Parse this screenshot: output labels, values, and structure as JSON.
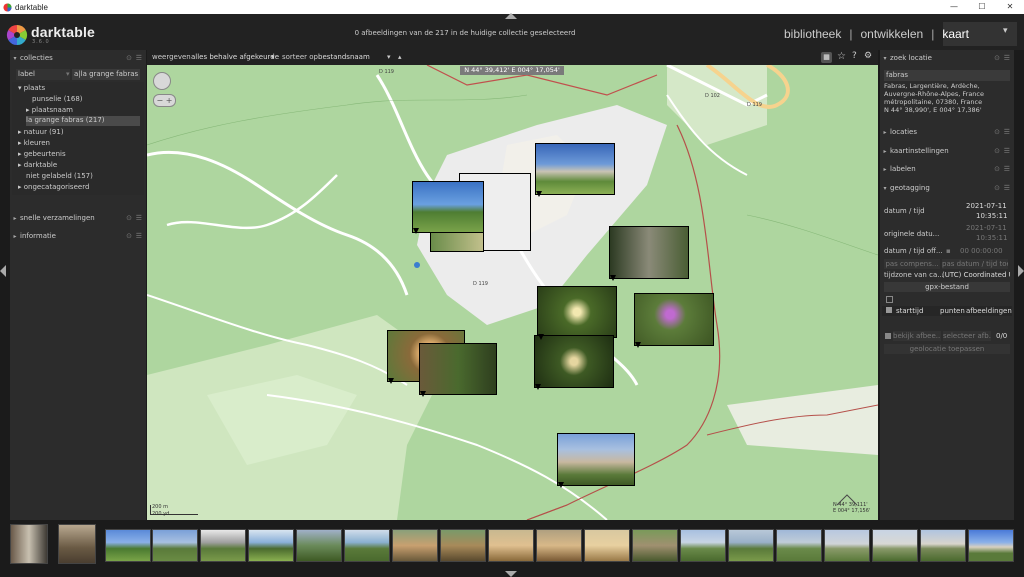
{
  "window": {
    "title": "darktable",
    "minimize": "—",
    "maximize": "☐",
    "close": "✕"
  },
  "header": {
    "logo_text": "darktable",
    "logo_sub": "3.6.0",
    "status": "0 afbeeldingen van de 217 in de huidige collectie geselecteerd",
    "views": [
      "bibliotheek",
      "ontwikkelen",
      "kaart"
    ],
    "active_view": "kaart",
    "views_dropdown": "▾"
  },
  "left": {
    "collecties": {
      "title": "collecties",
      "label_field": "label",
      "label_value": "a|la grange fabras",
      "tree": [
        {
          "text": "▾ plaats"
        },
        {
          "text": "punselie (168)"
        },
        {
          "text": "▸ plaatsnaam"
        },
        {
          "text": "la grange fabras (217)"
        },
        {
          "text": "▸ natuur (91)"
        },
        {
          "text": "▸ kleuren"
        },
        {
          "text": "▸ gebeurtenis"
        },
        {
          "text": "▸ darktable"
        },
        {
          "text": "niet gelabeld (157)"
        },
        {
          "text": "▸ ongecatagoriseerd"
        }
      ]
    },
    "snelle": {
      "title": "snelle verzamelingen"
    },
    "informatie": {
      "title": "informatie"
    }
  },
  "toolbar": {
    "weergeven_label": "weergeven",
    "weergeven_value": "alles behalve afgekeurde",
    "sorteer_label": "sorteer op",
    "sorteer_value": "bestandsnaam",
    "sort_dir": "▴"
  },
  "map": {
    "coords": "N 44° 39,412' E 004° 17,054'",
    "scale_m": "200 m",
    "scale_yd": "200 yd",
    "corner_coords": "N 44° 39,111'\nE 004° 17,156'",
    "road_labels": [
      "D 119",
      "D 119",
      "D 102",
      "D 119"
    ]
  },
  "right": {
    "zoek": {
      "title": "zoek locatie",
      "query": "fabras",
      "result": "Fabras, Largentière, Ardèche, Auvergne-Rhône-Alpes, France métropolitaine, 07380, France",
      "result_coords": "N 44° 38,990', E 004° 17,386'"
    },
    "locaties": {
      "title": "locaties"
    },
    "kaartinstellingen": {
      "title": "kaartinstellingen"
    },
    "labelen": {
      "title": "labelen"
    },
    "geotagging": {
      "title": "geotagging",
      "datum_tijd_label": "datum / tijd",
      "datum": "2021-07-11",
      "tijd": "10:35:11",
      "originele_label": "originele datu...",
      "originele_datum": "2021-07-11",
      "originele_tijd": "10:35:11",
      "offset_label": "datum / tijd off...",
      "offset_value": "00 00:00:00",
      "pas_compens": "pas compens...",
      "pas_datum": "pas datum / tijd toe",
      "tijdzone_label": "tijdzone van ca...",
      "tijdzone_value": "(UTC) Coordinated U",
      "gpx_button": "gpx-bestand",
      "col_starttijd": "starttijd",
      "col_punten": "punten",
      "col_afbeeldingen": "afbeeldingen",
      "bekijk": "bekijk afbee...",
      "selecteer": "selecteer afb...",
      "count": "0/0",
      "geolocatie": "geolocatie toepassen"
    }
  }
}
